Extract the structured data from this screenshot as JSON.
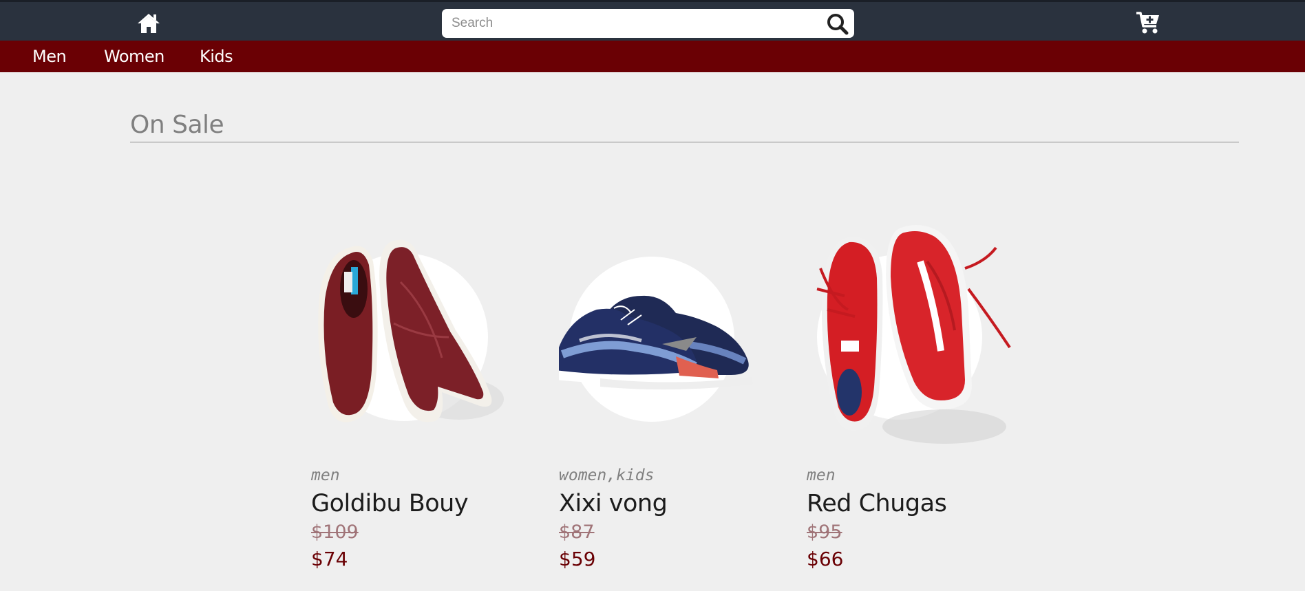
{
  "header": {
    "home_icon": "home-icon",
    "search": {
      "placeholder": "Search",
      "value": "",
      "icon": "search-icon"
    },
    "cart_icon": "cart-plus-icon",
    "colors": {
      "topbar": "#2a323e",
      "category_bar": "#6a0004"
    }
  },
  "categories": [
    {
      "label": "Men"
    },
    {
      "label": "Women"
    },
    {
      "label": "Kids"
    }
  ],
  "section": {
    "title": "On Sale"
  },
  "products": [
    {
      "category": "men",
      "name": "Goldibu Bouy",
      "old_price": "$109",
      "price": "$74"
    },
    {
      "category": "women,kids",
      "name": "Xixi vong",
      "old_price": "$87",
      "price": "$59"
    },
    {
      "category": "men",
      "name": "Red Chugas",
      "old_price": "$95",
      "price": "$66"
    }
  ]
}
